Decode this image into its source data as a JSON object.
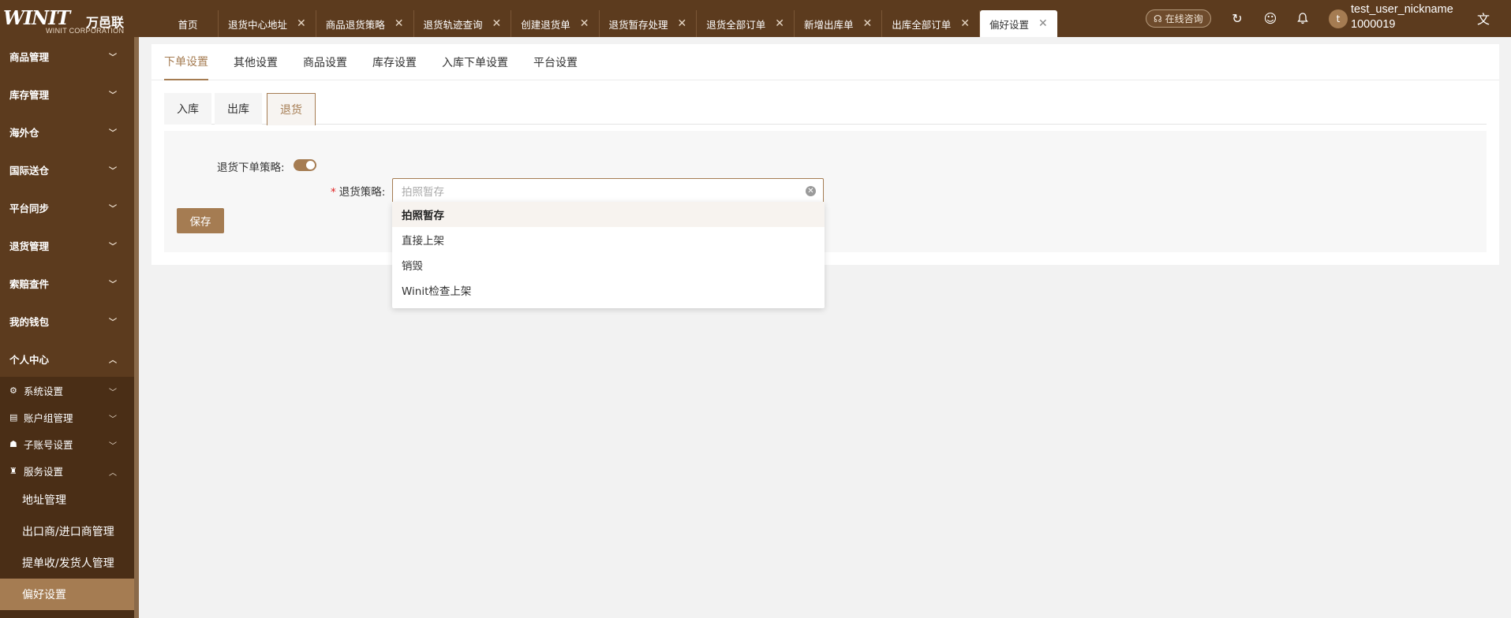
{
  "logo": {
    "mark": "WINIT",
    "cn": "万邑联",
    "sub": "WINIT CORPORATION"
  },
  "tabs": [
    {
      "label": "首页",
      "closable": false
    },
    {
      "label": "退货中心地址",
      "closable": true
    },
    {
      "label": "商品退货策略",
      "closable": true
    },
    {
      "label": "退货轨迹查询",
      "closable": true
    },
    {
      "label": "创建退货单",
      "closable": true
    },
    {
      "label": "退货暂存处理",
      "closable": true
    },
    {
      "label": "退货全部订单",
      "closable": true
    },
    {
      "label": "新增出库单",
      "closable": true
    },
    {
      "label": "出库全部订单",
      "closable": true
    },
    {
      "label": "偏好设置",
      "closable": true,
      "active": true
    }
  ],
  "header": {
    "consult_label": "在线咨询",
    "avatar_letter": "t",
    "user_name": "test_user_nickname",
    "user_id": "1000019"
  },
  "sidebar": {
    "groups": [
      {
        "label": "商品管理",
        "expanded": false
      },
      {
        "label": "库存管理",
        "expanded": false
      },
      {
        "label": "海外仓",
        "expanded": false
      },
      {
        "label": "国际送仓",
        "expanded": false
      },
      {
        "label": "平台同步",
        "expanded": false
      },
      {
        "label": "退货管理",
        "expanded": false
      },
      {
        "label": "索赔查件",
        "expanded": false
      },
      {
        "label": "我的钱包",
        "expanded": false
      },
      {
        "label": "个人中心",
        "expanded": true
      }
    ],
    "sub_items": [
      {
        "label": "系统设置",
        "icon": "gear-icon",
        "expanded": false
      },
      {
        "label": "账户组管理",
        "icon": "card-icon",
        "expanded": false
      },
      {
        "label": "子账号设置",
        "icon": "org-icon",
        "expanded": false
      },
      {
        "label": "服务设置",
        "icon": "shirt-icon",
        "expanded": true
      }
    ],
    "leaves": [
      {
        "label": "地址管理",
        "active": false
      },
      {
        "label": "出口商/进口商管理",
        "active": false
      },
      {
        "label": "提单收/发货人管理",
        "active": false
      },
      {
        "label": "偏好设置",
        "active": true
      }
    ]
  },
  "settings_tabs": [
    "下单设置",
    "其他设置",
    "商品设置",
    "库存设置",
    "入库下单设置",
    "平台设置"
  ],
  "content_tabs": [
    "入库",
    "出库",
    "退货"
  ],
  "form": {
    "strategy_toggle_label": "退货下单策略:",
    "strategy_toggle_on": true,
    "strategy_label": "退货策略:",
    "strategy_placeholder": "拍照暂存",
    "save_label": "保存"
  },
  "dropdown_options": [
    "拍照暂存",
    "直接上架",
    "销毁",
    "Winit检查上架"
  ],
  "colors": {
    "brand": "#5c3b1e",
    "accent": "#a57c52",
    "required": "#e02020"
  }
}
